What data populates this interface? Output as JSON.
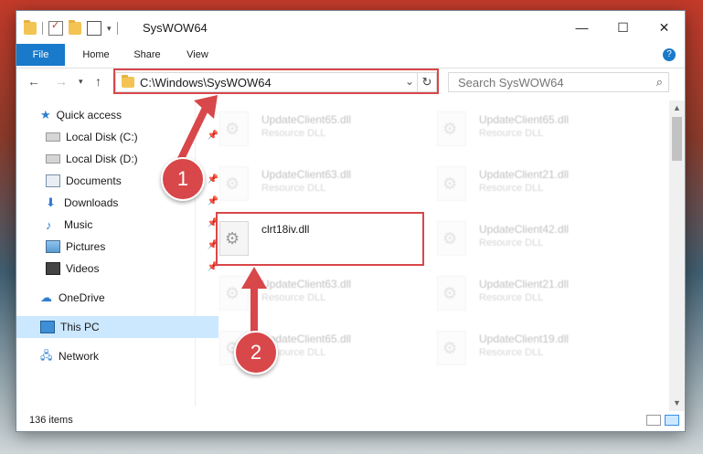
{
  "window": {
    "title": "SysWOW64",
    "controls": {
      "minimize": "—",
      "maximize": "☐",
      "close": "✕"
    }
  },
  "ribbon": {
    "tabs": [
      "File",
      "Home",
      "Share",
      "View"
    ],
    "help": "?"
  },
  "address_bar": {
    "path": "C:\\Windows\\SysWOW64",
    "search_placeholder": "Search SysWOW64"
  },
  "sidebar": {
    "items": [
      {
        "label": "Quick access",
        "icon": "star-icon"
      },
      {
        "label": "Local Disk (C:)",
        "icon": "drive-icon",
        "pinned": true
      },
      {
        "label": "Local Disk (D:)",
        "icon": "drive-icon"
      },
      {
        "label": "Documents",
        "icon": "documents-icon",
        "pinned": true
      },
      {
        "label": "Downloads",
        "icon": "download-icon",
        "pinned": true
      },
      {
        "label": "Music",
        "icon": "music-icon",
        "pinned": true
      },
      {
        "label": "Pictures",
        "icon": "pictures-icon",
        "pinned": true
      },
      {
        "label": "Videos",
        "icon": "videos-icon",
        "pinned": true
      },
      {
        "label": "OneDrive",
        "icon": "cloud-icon"
      },
      {
        "label": "This PC",
        "icon": "computer-icon",
        "selected": true
      },
      {
        "label": "Network",
        "icon": "network-icon"
      }
    ]
  },
  "files": [
    {
      "name": "UpdateClient65.dll",
      "type": "Resource DLL"
    },
    {
      "name": "UpdateClient65.dll",
      "type": "Resource DLL"
    },
    {
      "name": "UpdateClient63.dll",
      "type": "Resource DLL"
    },
    {
      "name": "UpdateClient21.dll",
      "type": "Resource DLL"
    },
    {
      "name": "clrt18iv.dll",
      "type": ""
    },
    {
      "name": "UpdateClient42.dll",
      "type": "Resource DLL"
    },
    {
      "name": "UpdateClient63.dll",
      "type": "Resource DLL"
    },
    {
      "name": "UpdateClient21.dll",
      "type": "Resource DLL"
    },
    {
      "name": "UpdateClient65.dll",
      "type": "Resource DLL"
    },
    {
      "name": "UpdateClient19.dll",
      "type": "Resource DLL"
    }
  ],
  "status": {
    "item_count": "136 items"
  },
  "annotations": {
    "step1": "1",
    "step2": "2",
    "color": "#d8474a"
  }
}
